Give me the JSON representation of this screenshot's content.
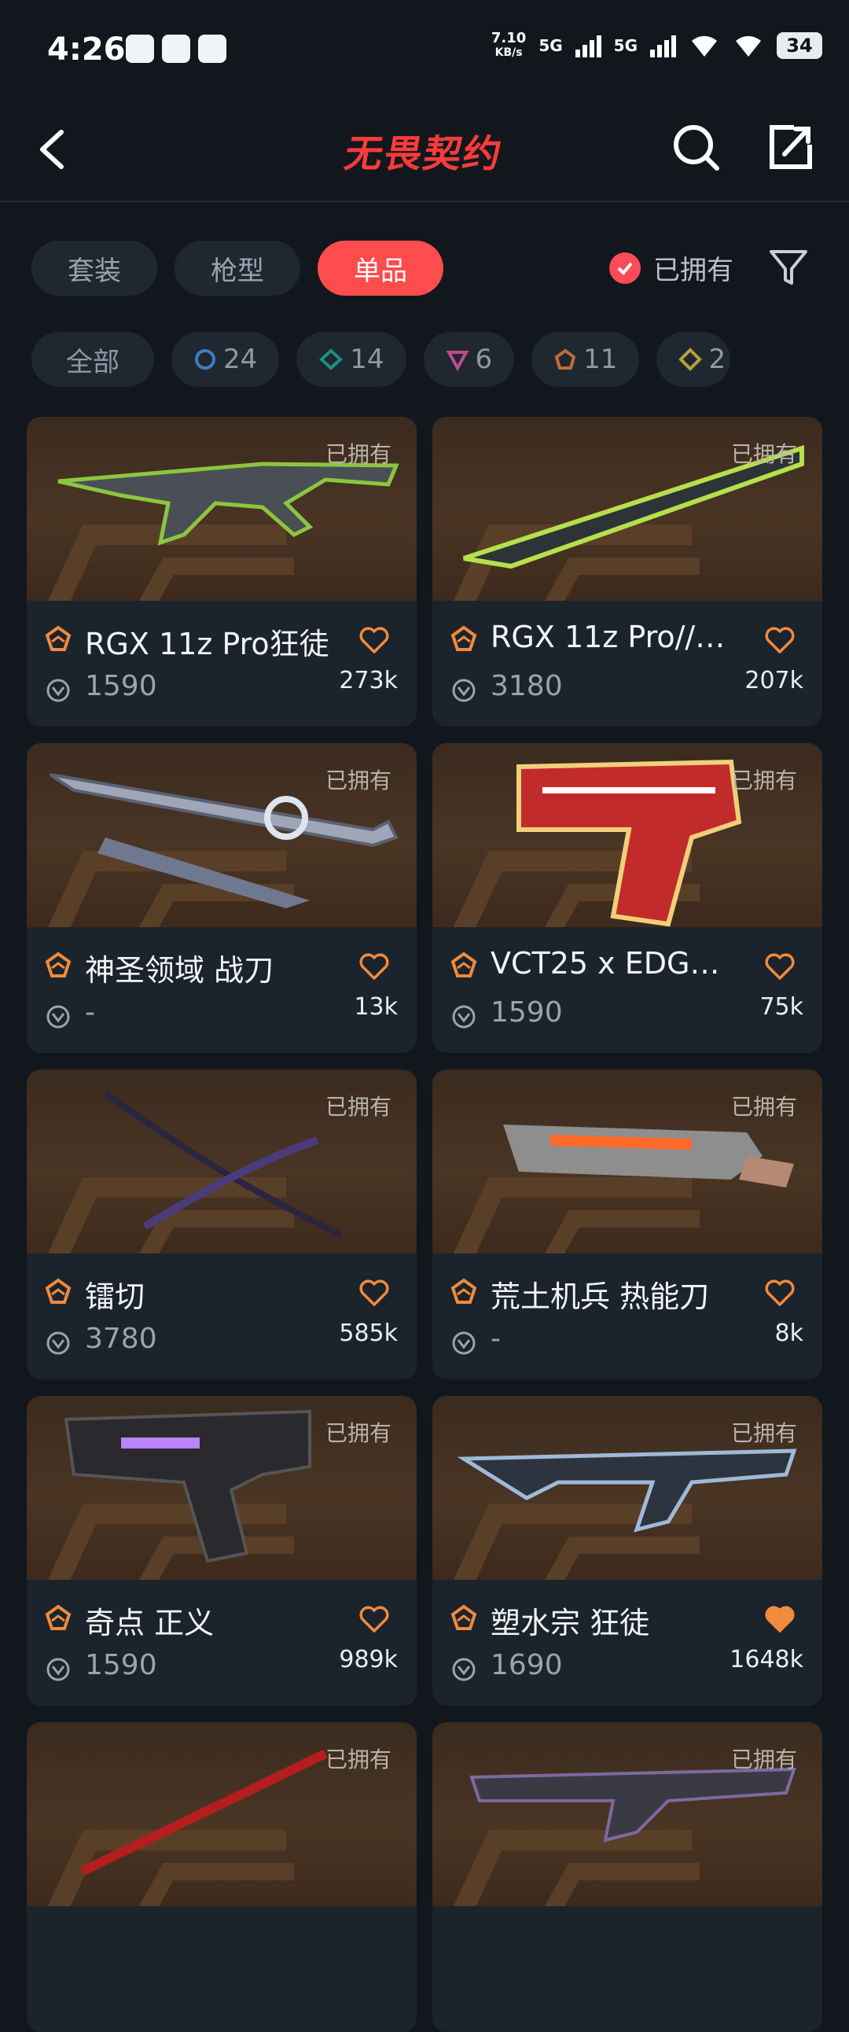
{
  "status": {
    "time": "4:26",
    "speed": "7.10",
    "speed_unit": "KB/s",
    "net1": "5G",
    "net2": "5G",
    "battery": "34"
  },
  "header": {
    "title": "无畏契约"
  },
  "type_tabs": [
    {
      "label": "套装",
      "active": false
    },
    {
      "label": "枪型",
      "active": false
    },
    {
      "label": "单品",
      "active": true
    }
  ],
  "owned_filter": {
    "label": "已拥有",
    "checked": true
  },
  "rarity_filters": [
    {
      "label": "全部",
      "icon": "none"
    },
    {
      "label": "24",
      "icon": "select-tier-icon",
      "color": "#3b7fc1"
    },
    {
      "label": "14",
      "icon": "deluxe-tier-icon",
      "color": "#1b8f82"
    },
    {
      "label": "6",
      "icon": "premium-tier-icon",
      "color": "#c04a8f"
    },
    {
      "label": "11",
      "icon": "exclusive-tier-icon",
      "color": "#c06b3a"
    },
    {
      "label": "2",
      "icon": "ultra-tier-icon",
      "color": "#b99f3a"
    }
  ],
  "cards": [
    {
      "name": "RGX 11z Pro狂徒",
      "price": "1590",
      "likes": "273k",
      "owned": "已拥有",
      "liked": false
    },
    {
      "name": "RGX 11z Pro//…",
      "price": "3180",
      "likes": "207k",
      "owned": "已拥有",
      "liked": false
    },
    {
      "name": "神圣领域 战刀",
      "price": "-",
      "likes": "13k",
      "owned": "已拥有",
      "liked": false
    },
    {
      "name": "VCT25 x EDG…",
      "price": "1590",
      "likes": "75k",
      "owned": "已拥有",
      "liked": false
    },
    {
      "name": "镭切",
      "price": "3780",
      "likes": "585k",
      "owned": "已拥有",
      "liked": false
    },
    {
      "name": "荒土机兵 热能刀",
      "price": "-",
      "likes": "8k",
      "owned": "已拥有",
      "liked": false
    },
    {
      "name": "奇点 正义",
      "price": "1590",
      "likes": "989k",
      "owned": "已拥有",
      "liked": false
    },
    {
      "name": "塑水宗 狂徒",
      "price": "1690",
      "likes": "1648k",
      "owned": "已拥有",
      "liked": true
    },
    {
      "owned": "已拥有"
    },
    {
      "owned": "已拥有"
    }
  ],
  "colors": {
    "accent": "#ff4c4c",
    "heart": "#f28a3c",
    "bg": "#11171d",
    "card": "#1b232c"
  }
}
